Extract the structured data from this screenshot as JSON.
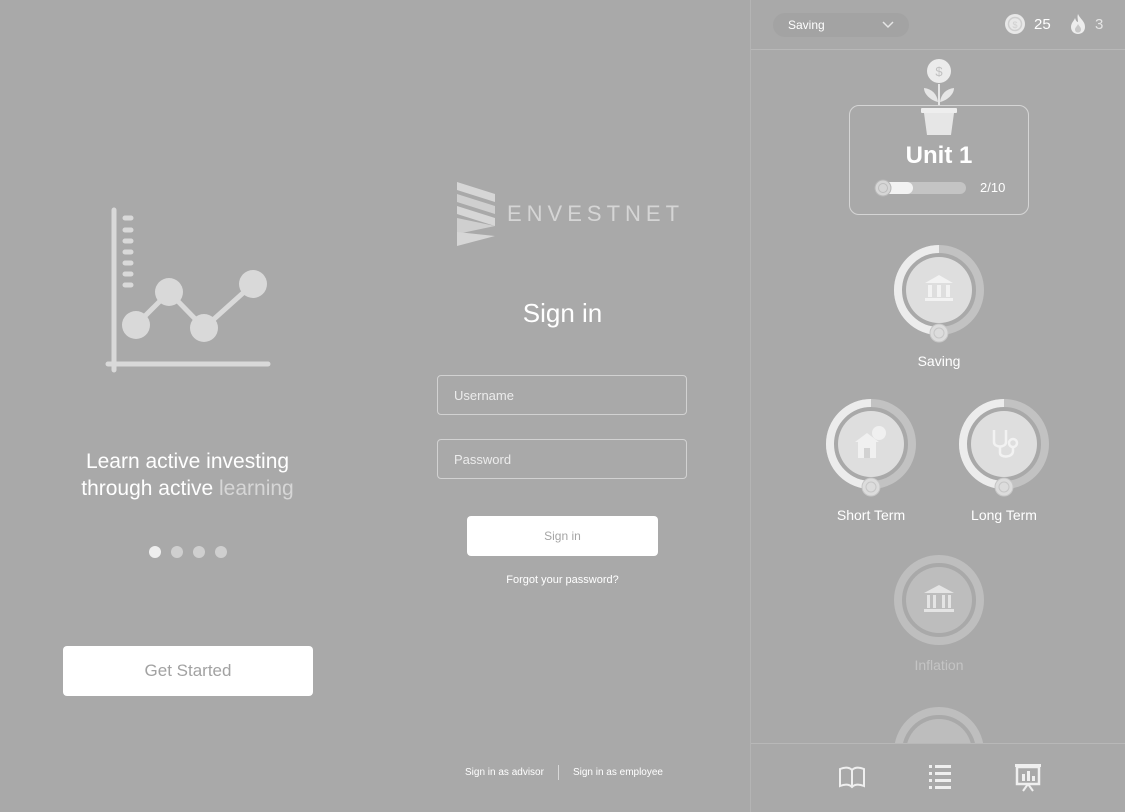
{
  "onboarding": {
    "tagline_main": "Learn active investing",
    "tagline_line2_prefix": "through active ",
    "tagline_line2_highlight": "learning",
    "pagination": {
      "count": 4,
      "active_index": 0
    },
    "cta_label": "Get Started",
    "illustration_icon": "line-chart-illustration"
  },
  "signin": {
    "logo_text": "ENVESTNET",
    "title": "Sign in",
    "username_placeholder": "Username",
    "password_placeholder": "Password",
    "submit_label": "Sign in",
    "forgot_label": "Forgot your password?",
    "advisor_link": "Sign in as advisor",
    "employee_link": "Sign in as employee"
  },
  "learning_path": {
    "topic_select": "Saving",
    "coins": "25",
    "streak": "3",
    "unit": {
      "title": "Unit 1",
      "progress_text": "2/10",
      "progress_fraction": 0.2
    },
    "lessons": [
      {
        "label": "Saving",
        "icon": "bank-icon",
        "state": "in-progress"
      },
      {
        "label": "Short Term",
        "icon": "house-icon",
        "state": "in-progress"
      },
      {
        "label": "Long Term",
        "icon": "stethoscope-icon",
        "state": "in-progress"
      },
      {
        "label": "Inflation",
        "icon": "bank-icon",
        "state": "locked"
      }
    ],
    "nav": [
      "book-icon",
      "list-icon",
      "presentation-chart-icon"
    ]
  },
  "colors": {
    "background": "#a9a9a9",
    "button": "#ffffff",
    "muted_text": "#d6d6d6"
  }
}
